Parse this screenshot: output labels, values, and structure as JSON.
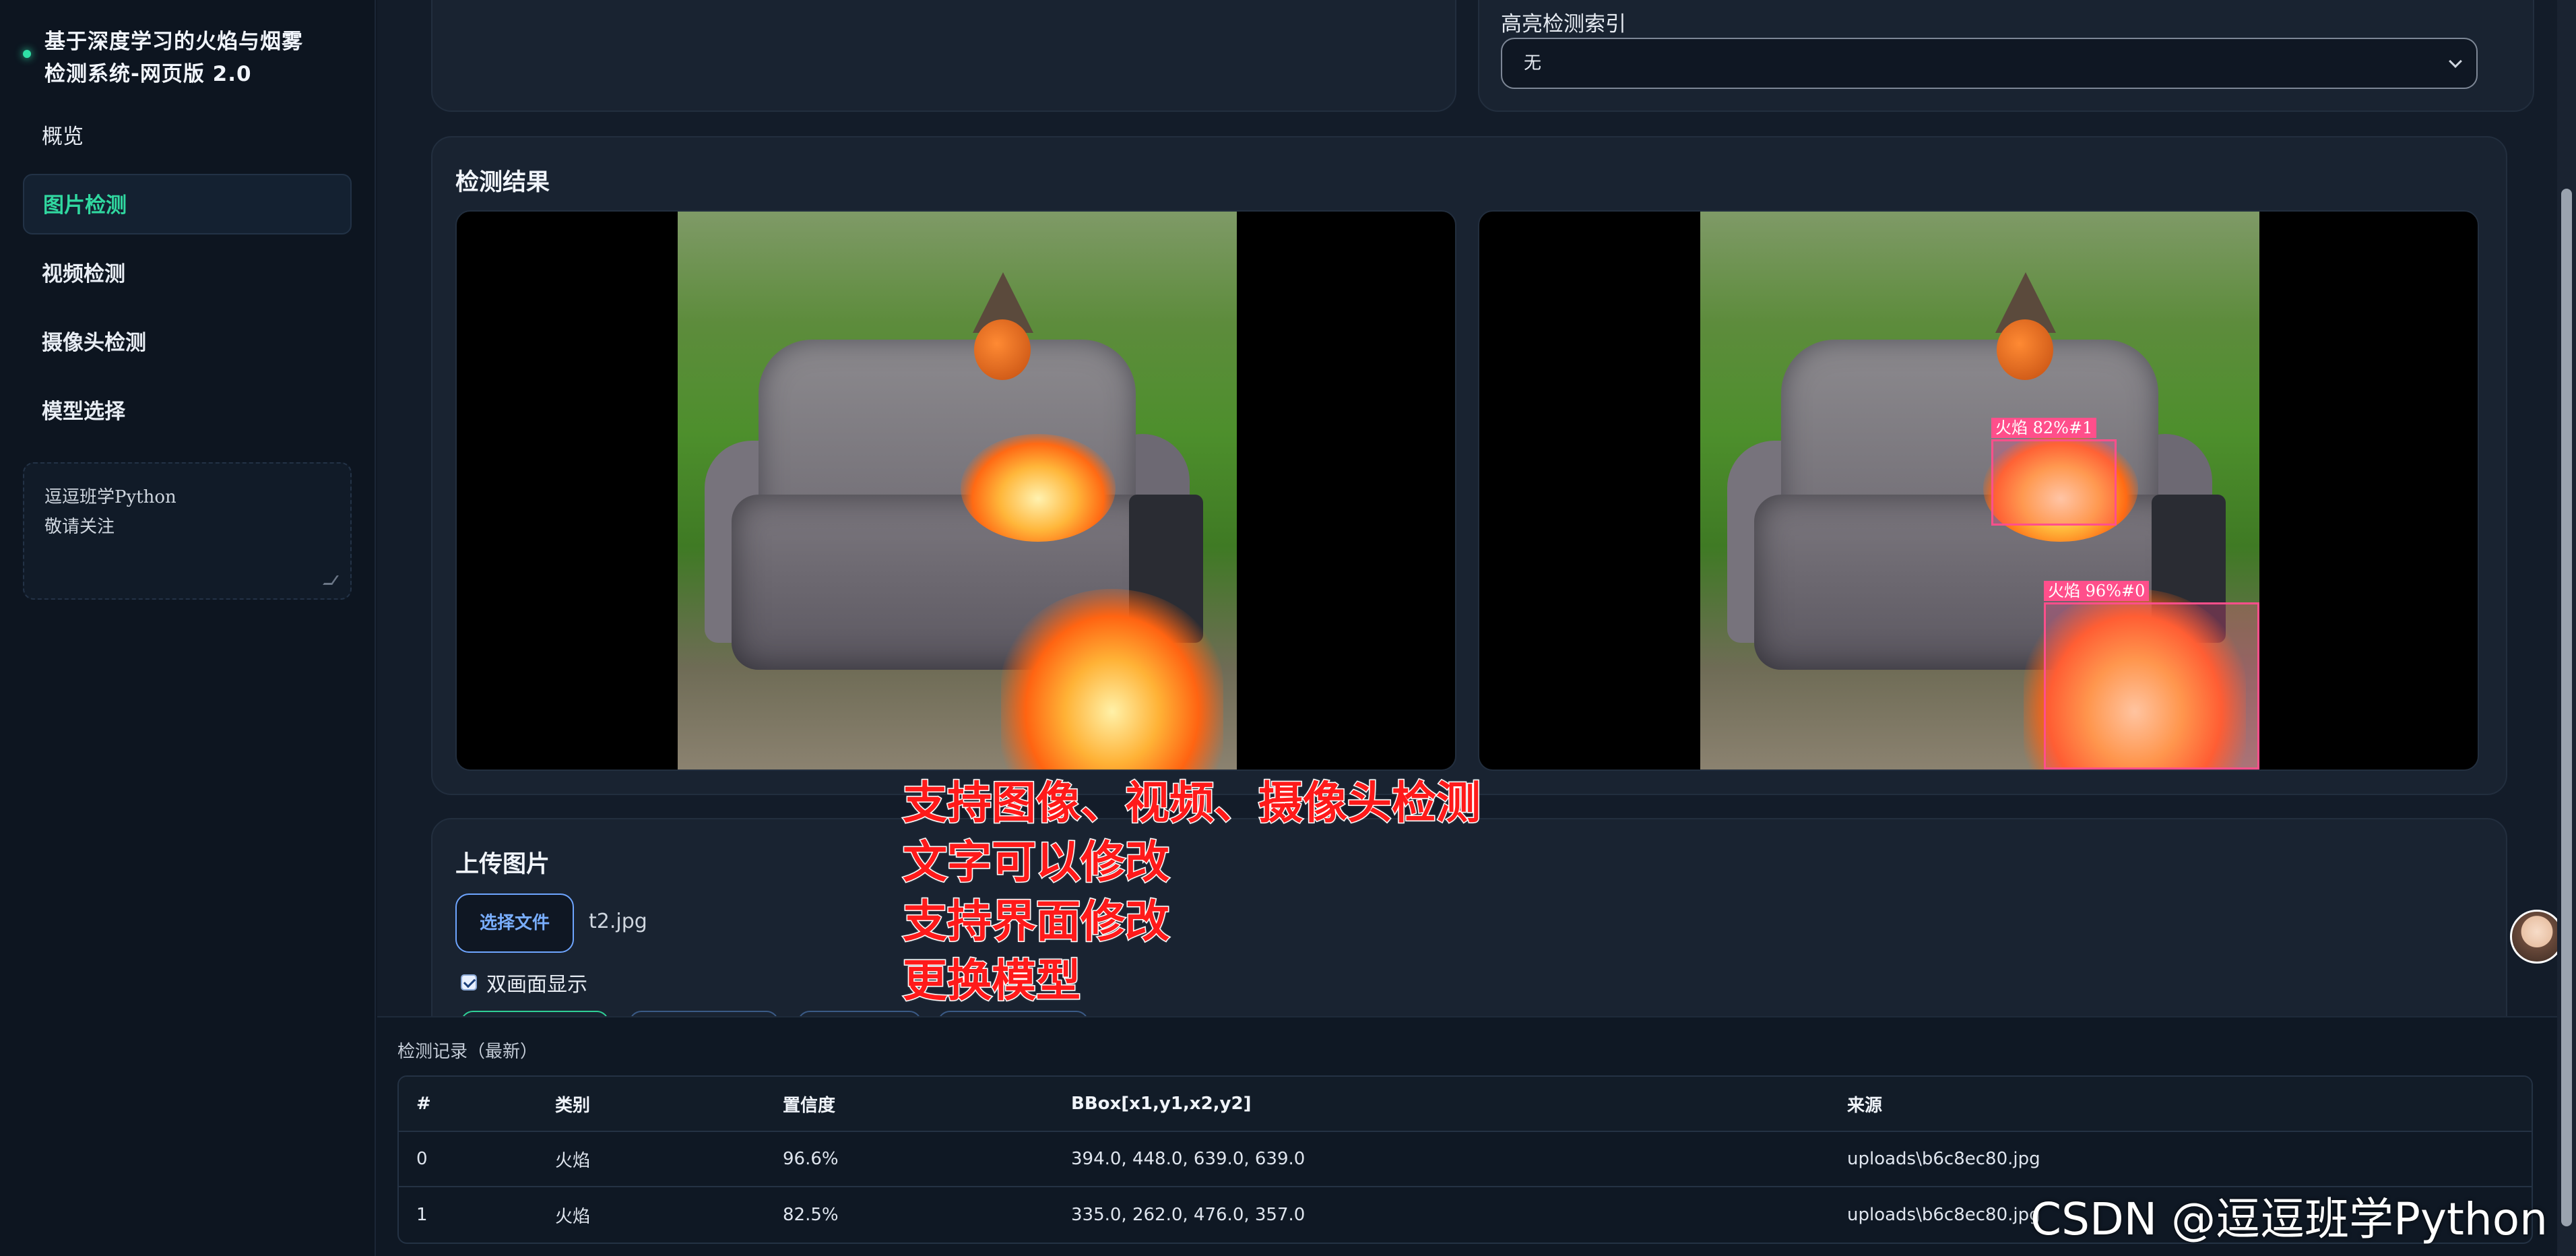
{
  "app": {
    "title_line1": "基于深度学习的火焰与烟雾",
    "title_line2": "检测系统-网页版 2.0"
  },
  "sidebar": {
    "items": [
      {
        "label": "概览",
        "active": false
      },
      {
        "label": "图片检测",
        "active": true
      },
      {
        "label": "视频检测",
        "active": false
      },
      {
        "label": "摄像头检测",
        "active": false
      },
      {
        "label": "模型选择",
        "active": false
      }
    ],
    "notes_line1": "逗逗班学Python",
    "notes_line2": "敬请关注"
  },
  "highlight": {
    "label": "高亮检测索引",
    "selected": "无"
  },
  "results": {
    "title": "检测结果",
    "detections": [
      {
        "label": "火焰 82%#1",
        "box": [
          335.0,
          262.0,
          476.0,
          357.0
        ]
      },
      {
        "label": "火焰 96%#0",
        "box": [
          394.0,
          448.0,
          639.0,
          639.0
        ]
      }
    ]
  },
  "upload": {
    "title": "上传图片",
    "choose_label": "选择文件",
    "filename": "t2.jpg",
    "dual_view_label": "双画面显示",
    "dual_view_checked": true
  },
  "overlay_text": [
    "支持图像、视频、摄像头检测",
    "文字可以修改",
    "支持界面修改",
    "更换模型"
  ],
  "log": {
    "title": "检测记录（最新）",
    "columns": [
      "#",
      "类别",
      "置信度",
      "BBox[x1,y1,x2,y2]",
      "来源"
    ],
    "rows": [
      [
        "0",
        "火焰",
        "96.6%",
        "394.0, 448.0, 639.0, 639.0",
        "uploads\\b6c8ec80.jpg"
      ],
      [
        "1",
        "火焰",
        "82.5%",
        "335.0, 262.0, 476.0, 357.0",
        "uploads\\b6c8ec80.jpg"
      ]
    ]
  },
  "watermark": "CSDN @逗逗班学Python",
  "colors": {
    "accent": "#30d8a0",
    "box": "#ff4f8b",
    "link": "#79aeff",
    "overlay_text": "#ff1a1a"
  }
}
